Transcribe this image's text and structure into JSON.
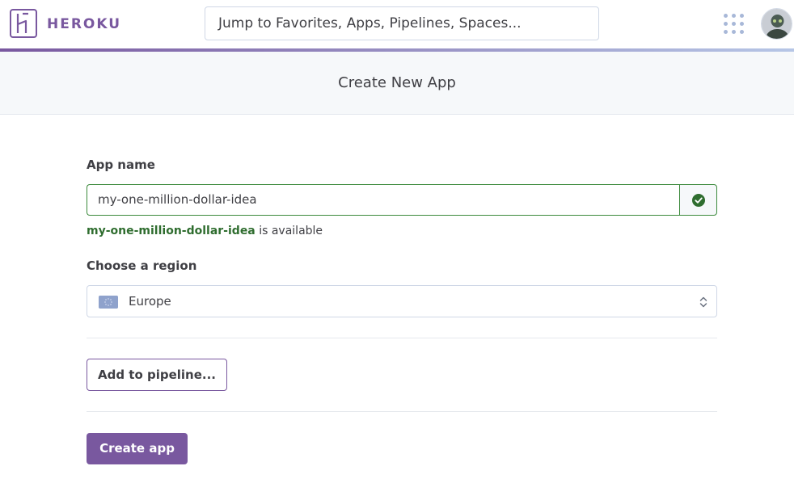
{
  "colors": {
    "brand": "#79589f",
    "success": "#3c8a3c",
    "success_text": "#2f6d2f",
    "nav_rule_start": "#79589f",
    "nav_rule_end": "#b6c6e6"
  },
  "nav": {
    "logo_icon": "heroku-logo-icon",
    "brand_name": "HEROKU",
    "search": {
      "placeholder": "Jump to Favorites, Apps, Pipelines, Spaces..."
    },
    "apps_icon": "apps-grid-icon",
    "avatar_icon": "user-avatar"
  },
  "header": {
    "title": "Create New App"
  },
  "form": {
    "app_name": {
      "label": "App name",
      "value": "my-one-million-dollar-idea",
      "status_icon": "check-circle-icon",
      "availability_name": "my-one-million-dollar-idea",
      "availability_suffix": " is available"
    },
    "region": {
      "label": "Choose a region",
      "selected": "Europe",
      "flag_icon": "eu-flag-icon",
      "arrows_icon": "select-arrows-icon"
    },
    "pipeline_button": "Add to pipeline...",
    "create_button": "Create app"
  }
}
